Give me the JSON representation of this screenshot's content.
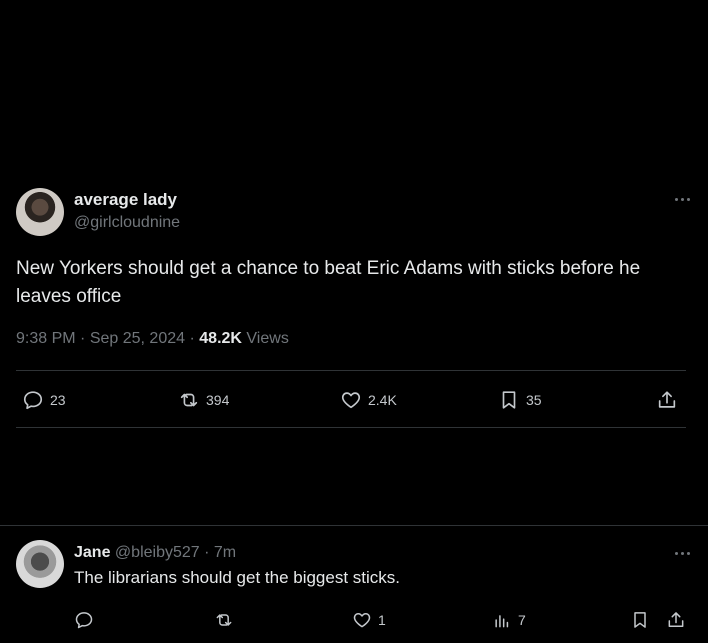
{
  "post": {
    "author_name": "average lady",
    "author_handle": "@girlcloudnine",
    "text": "New Yorkers should get a chance to beat Eric Adams with sticks before he leaves office",
    "time": "9:38 PM",
    "separator": "·",
    "date": "Sep 25, 2024",
    "views_count": "48.2K",
    "views_label": "Views",
    "actions": {
      "replies": "23",
      "reposts": "394",
      "likes": "2.4K",
      "bookmarks": "35"
    }
  },
  "reply": {
    "author_name": "Jane",
    "author_handle": "@bleiby527",
    "time_ago": "· 7m",
    "text": "The librarians should get the biggest sticks.",
    "actions": {
      "likes": "1",
      "views": "7"
    }
  },
  "colors": {
    "background": "#000000",
    "primary_text": "#e7e9ea",
    "secondary_text": "#71767b",
    "divider": "#2f3336"
  }
}
